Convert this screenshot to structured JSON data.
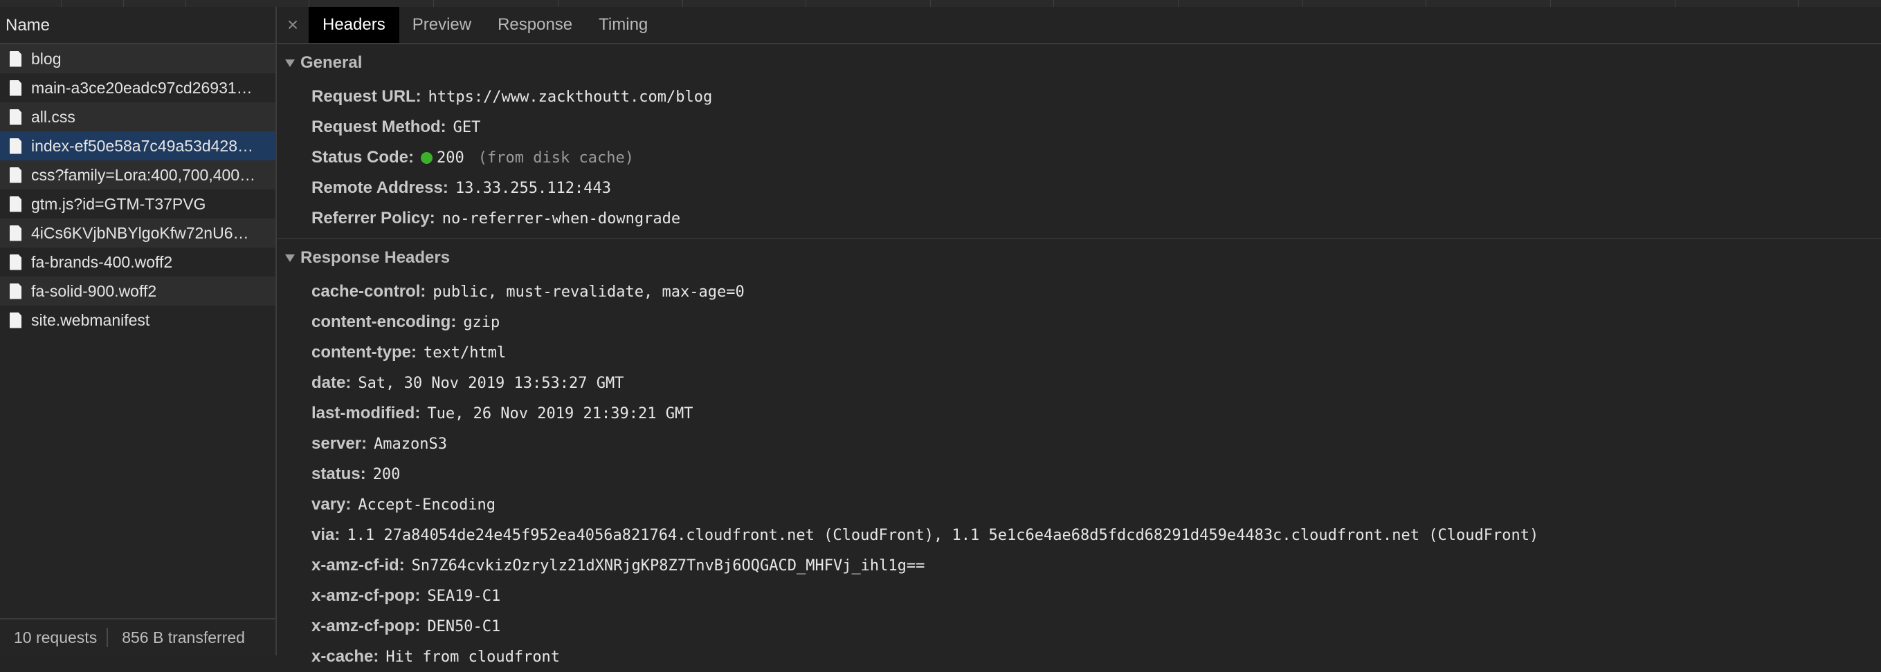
{
  "network": {
    "name_header": "Name",
    "requests": [
      {
        "name": "blog"
      },
      {
        "name": "main-a3ce20eadc97cd26931…"
      },
      {
        "name": "all.css"
      },
      {
        "name": "index-ef50e58a7c49a53d428…"
      },
      {
        "name": "css?family=Lora:400,700,400…"
      },
      {
        "name": "gtm.js?id=GTM-T37PVG"
      },
      {
        "name": "4iCs6KVjbNBYlgoKfw72nU6…"
      },
      {
        "name": "fa-brands-400.woff2"
      },
      {
        "name": "fa-solid-900.woff2"
      },
      {
        "name": "site.webmanifest"
      }
    ],
    "selected_index": 3,
    "status": {
      "requests": "10 requests",
      "transferred": "856 B transferred"
    }
  },
  "detail": {
    "close_icon": "close-icon",
    "tabs": [
      {
        "label": "Headers",
        "active": true
      },
      {
        "label": "Preview"
      },
      {
        "label": "Response"
      },
      {
        "label": "Timing"
      }
    ],
    "general": {
      "title": "General",
      "request_url_label": "Request URL:",
      "request_url": "https://www.zackthoutt.com/blog",
      "request_method_label": "Request Method:",
      "request_method": "GET",
      "status_code_label": "Status Code:",
      "status_code": "200",
      "status_note": "(from disk cache)",
      "status_color": "#3cb02a",
      "remote_address_label": "Remote Address:",
      "remote_address": "13.33.255.112:443",
      "referrer_policy_label": "Referrer Policy:",
      "referrer_policy": "no-referrer-when-downgrade"
    },
    "response_headers": {
      "title": "Response Headers",
      "items": [
        {
          "key": "cache-control:",
          "value": "public, must-revalidate, max-age=0"
        },
        {
          "key": "content-encoding:",
          "value": "gzip"
        },
        {
          "key": "content-type:",
          "value": "text/html"
        },
        {
          "key": "date:",
          "value": "Sat, 30 Nov 2019 13:53:27 GMT"
        },
        {
          "key": "last-modified:",
          "value": "Tue, 26 Nov 2019 21:39:21 GMT"
        },
        {
          "key": "server:",
          "value": "AmazonS3"
        },
        {
          "key": "status:",
          "value": "200"
        },
        {
          "key": "vary:",
          "value": "Accept-Encoding"
        },
        {
          "key": "via:",
          "value": "1.1 27a84054de24e45f952ea4056a821764.cloudfront.net (CloudFront), 1.1 5e1c6e4ae68d5fdcd68291d459e4483c.cloudfront.net (CloudFront)"
        },
        {
          "key": "x-amz-cf-id:",
          "value": "Sn7Z64cvkizOzrylz21dXNRjgKP8Z7TnvBj6OQGACD_MHFVj_ihl1g=="
        },
        {
          "key": "x-amz-cf-pop:",
          "value": "SEA19-C1"
        },
        {
          "key": "x-amz-cf-pop:",
          "value": "DEN50-C1"
        },
        {
          "key": "x-cache:",
          "value": "Hit from cloudfront"
        }
      ]
    }
  }
}
